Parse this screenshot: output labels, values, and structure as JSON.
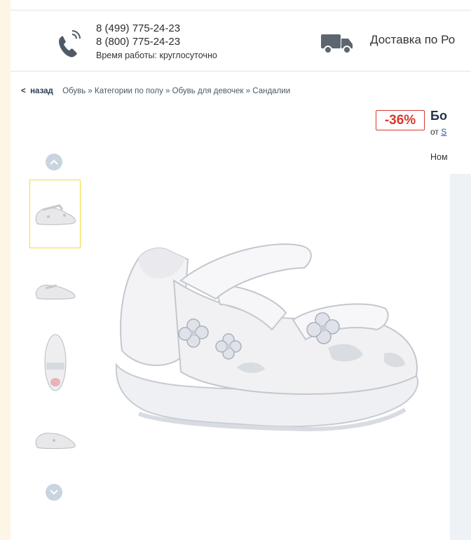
{
  "header": {
    "phones": [
      "8 (499) 775-24-23",
      "8 (800) 775-24-23"
    ],
    "hours": "Время работы: круглосуточно",
    "delivery": "Доставка по Ро"
  },
  "breadcrumb": {
    "back": "назад",
    "back_arrow": "<",
    "separator": "»",
    "items": [
      "Обувь",
      "Категории по полу",
      "Обувь для девочек",
      "Сандалии"
    ]
  },
  "product": {
    "discount": "-36%",
    "title": "Бо",
    "brand_prefix": "от",
    "brand_link": "S",
    "sku_label": "Ном"
  },
  "gallery": {
    "thumbnails": [
      "sandal-side-view",
      "sandal-side-view-2",
      "sandal-top-view",
      "sandal-angle-view"
    ],
    "active_index": 0,
    "up_icon": "chevron-up-icon",
    "down_icon": "chevron-down-icon"
  },
  "colors": {
    "discount": "#d63a2e",
    "active_thumb_border": "#f1dd3a",
    "arrow_button": "#c9d4e0",
    "page_bg": "#fdf6e6"
  }
}
